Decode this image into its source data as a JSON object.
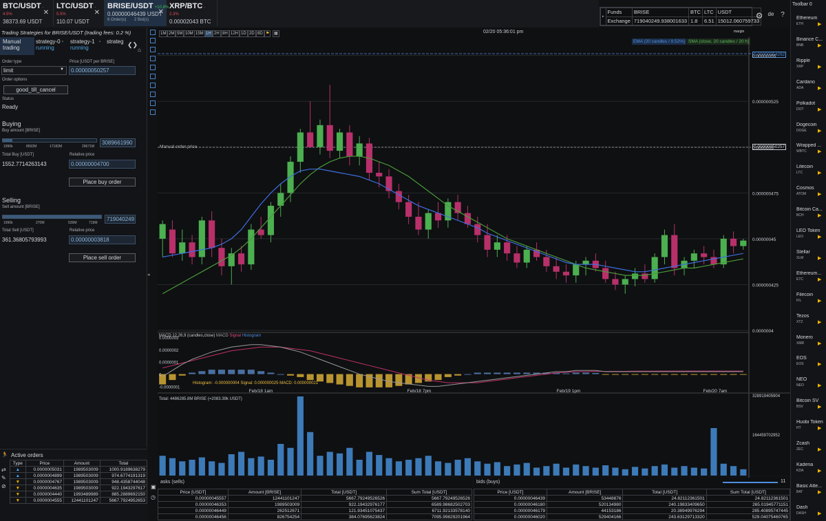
{
  "tabs": [
    {
      "symbol": "BTC/USDT",
      "change": "-4.5%",
      "price": "38373.69 USDT",
      "active": false
    },
    {
      "symbol": "LTC/USDT",
      "change": "-5.5%",
      "price": "110.07 USDT",
      "active": false
    },
    {
      "symbol": "BRISE/USDT",
      "change": "+10.8%",
      "price": "0.00000046439 USDT",
      "orders": "6 Order(s)",
      "bots": "2 Bot(s)",
      "active": true
    },
    {
      "symbol": "XRP/BTC",
      "change": "-2.3%",
      "price": "0.00002043 BTC",
      "active": false
    }
  ],
  "funds": {
    "h": [
      "Funds",
      "BRISE",
      "BTC",
      "LTC",
      "USDT"
    ],
    "row_label": "Exchange",
    "vals": [
      "719040249.938001633",
      "1.8",
      "6.51",
      "15012.060759733"
    ]
  },
  "right_toolbar": {
    "title": "Toolbar 0",
    "lang": "de"
  },
  "left": {
    "title": "Trading Strategies for BRISE/USDT (trading fees: 0.2 %)",
    "strategy_tabs": [
      {
        "name": "Manual trading",
        "status": ""
      },
      {
        "name": "strategy-0",
        "status": "running"
      },
      {
        "name": "strategy-1",
        "status": "running"
      },
      {
        "name": "strateg",
        "status": ""
      }
    ],
    "order_type_label": "Order type",
    "order_type": "limit",
    "price_label": "Price [USDT per BRISE]",
    "price": "0.00000050257",
    "order_options_label": "Order options",
    "order_option": "good_till_cancel",
    "status_label": "Status",
    "status": "Ready",
    "buying": "Buying",
    "buy_amount_label": "Buy amount [BRISE]",
    "buy_ticks": [
      "1990k",
      "8592M",
      "17182M",
      "29671M"
    ],
    "buy_amount": "3089661990",
    "buy_fill": 0.1,
    "total_buy_label": "Total Buy [USDT]",
    "total_buy": "1552.7714263143",
    "rel_price_label": "Relative price",
    "buy_rel_price": "0.00000004700",
    "place_buy": "Place buy order",
    "selling": "Selling",
    "sell_amount_label": "Sell amount [BRISE]",
    "sell_ticks": [
      "1990k",
      "270M",
      "539M",
      "719M"
    ],
    "sell_amount": "719040249",
    "sell_fill": 1.0,
    "total_sell_label": "Total Sell [USDT]",
    "total_sell": "361.36805793993",
    "sell_rel_price": "0.00000003818",
    "place_sell": "Place sell order"
  },
  "timeframes": [
    "1M",
    "2M",
    "5M",
    "10M",
    "15M",
    "1H",
    "2H",
    "8H",
    "12H",
    "1D",
    "2D",
    "8D"
  ],
  "selected_timeframe": "1H",
  "chart_header": {
    "datetime": "02/20 05:36:01 pm",
    "margin": "margin"
  },
  "legend": {
    "ema": "EMA (20 candles / 9.52%)",
    "sma": "SMA (close, 20 candles / 20 h)"
  },
  "manual_order_label": "Manual order price",
  "price_axis": [
    "0.00000055",
    "0.000000525",
    "0.0000005",
    "0.000000475",
    "0.00000045",
    "0.000000425",
    "0.0000004"
  ],
  "price_tags": {
    "top": "0.00000054292",
    "manual": "0.00000050257"
  },
  "x_axis": [
    "Feb/18 1am",
    "Feb/18 7pm",
    "Feb/19 1pm",
    "Feb/20 7am"
  ],
  "macd": {
    "title": "MACD 12,26,9 (candles,close)",
    "legend": [
      "MACD",
      "Signal",
      "Histogram"
    ],
    "axis": [
      "0.0000003",
      "0.0000002",
      "0.0000001",
      "0",
      "-0.0000001"
    ],
    "footer": "Histogram: -0.000000004  Signal: 0.000000025  MACD: 0.000000021"
  },
  "volume": {
    "title": "Total: 4486285.8M BRISE (=2083.39k USDT)",
    "axis_top": "328919405904",
    "axis_mid": "164459702952"
  },
  "chart_data": {
    "type": "bar",
    "candles": [
      {
        "o": 0.45,
        "h": 0.46,
        "l": 0.44,
        "c": 0.458
      },
      {
        "o": 0.455,
        "h": 0.46,
        "l": 0.44,
        "c": 0.442
      },
      {
        "o": 0.442,
        "h": 0.455,
        "l": 0.438,
        "c": 0.448
      },
      {
        "o": 0.448,
        "h": 0.452,
        "l": 0.436,
        "c": 0.44
      },
      {
        "o": 0.44,
        "h": 0.462,
        "l": 0.436,
        "c": 0.46
      },
      {
        "o": 0.46,
        "h": 0.465,
        "l": 0.44,
        "c": 0.445
      },
      {
        "o": 0.445,
        "h": 0.45,
        "l": 0.43,
        "c": 0.435
      },
      {
        "o": 0.435,
        "h": 0.445,
        "l": 0.425,
        "c": 0.442
      },
      {
        "o": 0.442,
        "h": 0.446,
        "l": 0.432,
        "c": 0.436
      },
      {
        "o": 0.436,
        "h": 0.458,
        "l": 0.433,
        "c": 0.455
      },
      {
        "o": 0.455,
        "h": 0.462,
        "l": 0.45,
        "c": 0.452
      },
      {
        "o": 0.452,
        "h": 0.47,
        "l": 0.448,
        "c": 0.468
      },
      {
        "o": 0.468,
        "h": 0.48,
        "l": 0.462,
        "c": 0.475
      },
      {
        "o": 0.475,
        "h": 0.495,
        "l": 0.47,
        "c": 0.492
      },
      {
        "o": 0.492,
        "h": 0.51,
        "l": 0.486,
        "c": 0.508
      },
      {
        "o": 0.508,
        "h": 0.525,
        "l": 0.5,
        "c": 0.5
      },
      {
        "o": 0.5,
        "h": 0.515,
        "l": 0.496,
        "c": 0.512
      },
      {
        "o": 0.512,
        "h": 0.534,
        "l": 0.494,
        "c": 0.498
      },
      {
        "o": 0.498,
        "h": 0.51,
        "l": 0.494,
        "c": 0.508
      },
      {
        "o": 0.508,
        "h": 0.512,
        "l": 0.49,
        "c": 0.495
      },
      {
        "o": 0.495,
        "h": 0.506,
        "l": 0.49,
        "c": 0.502
      },
      {
        "o": 0.502,
        "h": 0.505,
        "l": 0.482,
        "c": 0.486
      },
      {
        "o": 0.486,
        "h": 0.492,
        "l": 0.478,
        "c": 0.484
      },
      {
        "o": 0.484,
        "h": 0.488,
        "l": 0.472,
        "c": 0.476
      },
      {
        "o": 0.476,
        "h": 0.48,
        "l": 0.466,
        "c": 0.47
      },
      {
        "o": 0.47,
        "h": 0.474,
        "l": 0.458,
        "c": 0.462
      },
      {
        "o": 0.462,
        "h": 0.47,
        "l": 0.452,
        "c": 0.455
      },
      {
        "o": 0.455,
        "h": 0.466,
        "l": 0.45,
        "c": 0.464
      },
      {
        "o": 0.464,
        "h": 0.47,
        "l": 0.456,
        "c": 0.46
      },
      {
        "o": 0.46,
        "h": 0.472,
        "l": 0.456,
        "c": 0.47
      },
      {
        "o": 0.47,
        "h": 0.474,
        "l": 0.46,
        "c": 0.464
      },
      {
        "o": 0.464,
        "h": 0.468,
        "l": 0.456,
        "c": 0.458
      },
      {
        "o": 0.458,
        "h": 0.462,
        "l": 0.448,
        "c": 0.452
      },
      {
        "o": 0.452,
        "h": 0.458,
        "l": 0.44,
        "c": 0.444
      },
      {
        "o": 0.444,
        "h": 0.452,
        "l": 0.44,
        "c": 0.448
      },
      {
        "o": 0.448,
        "h": 0.452,
        "l": 0.438,
        "c": 0.442
      },
      {
        "o": 0.442,
        "h": 0.446,
        "l": 0.434,
        "c": 0.437
      },
      {
        "o": 0.437,
        "h": 0.446,
        "l": 0.434,
        "c": 0.444
      },
      {
        "o": 0.444,
        "h": 0.448,
        "l": 0.438,
        "c": 0.44
      },
      {
        "o": 0.44,
        "h": 0.444,
        "l": 0.432,
        "c": 0.435
      },
      {
        "o": 0.435,
        "h": 0.44,
        "l": 0.428,
        "c": 0.432
      },
      {
        "o": 0.432,
        "h": 0.436,
        "l": 0.426,
        "c": 0.43
      },
      {
        "o": 0.43,
        "h": 0.438,
        "l": 0.426,
        "c": 0.436
      },
      {
        "o": 0.436,
        "h": 0.44,
        "l": 0.43,
        "c": 0.438
      },
      {
        "o": 0.438,
        "h": 0.442,
        "l": 0.432,
        "c": 0.434
      },
      {
        "o": 0.434,
        "h": 0.438,
        "l": 0.426,
        "c": 0.428
      },
      {
        "o": 0.428,
        "h": 0.432,
        "l": 0.422,
        "c": 0.425
      },
      {
        "o": 0.425,
        "h": 0.43,
        "l": 0.42,
        "c": 0.428
      },
      {
        "o": 0.428,
        "h": 0.434,
        "l": 0.424,
        "c": 0.431
      },
      {
        "o": 0.431,
        "h": 0.436,
        "l": 0.426,
        "c": 0.428
      },
      {
        "o": 0.428,
        "h": 0.442,
        "l": 0.426,
        "c": 0.44
      },
      {
        "o": 0.44,
        "h": 0.455,
        "l": 0.436,
        "c": 0.452
      },
      {
        "o": 0.452,
        "h": 0.458,
        "l": 0.43,
        "c": 0.434
      },
      {
        "o": 0.434,
        "h": 0.44,
        "l": 0.43,
        "c": 0.438
      },
      {
        "o": 0.438,
        "h": 0.444,
        "l": 0.434,
        "c": 0.442
      },
      {
        "o": 0.442,
        "h": 0.446,
        "l": 0.436,
        "c": 0.44
      },
      {
        "o": 0.44,
        "h": 0.444,
        "l": 0.434,
        "c": 0.436
      },
      {
        "o": 0.436,
        "h": 0.452,
        "l": 0.434,
        "c": 0.45
      },
      {
        "o": 0.45,
        "h": 0.454,
        "l": 0.442,
        "c": 0.446
      },
      {
        "o": 0.446,
        "h": 0.45,
        "l": 0.444,
        "c": 0.449
      }
    ],
    "ema": [
      0.44,
      0.441,
      0.442,
      0.443,
      0.444,
      0.445,
      0.447,
      0.45,
      0.455,
      0.462,
      0.469,
      0.475,
      0.48,
      0.484,
      0.487,
      0.488,
      0.488,
      0.487,
      0.486,
      0.485,
      0.484,
      0.482,
      0.48,
      0.477,
      0.474,
      0.471,
      0.468,
      0.466,
      0.464,
      0.462,
      0.46,
      0.458,
      0.456,
      0.453,
      0.451,
      0.449,
      0.447,
      0.445,
      0.443,
      0.441,
      0.439,
      0.437,
      0.436,
      0.436,
      0.436,
      0.435,
      0.434,
      0.433,
      0.432,
      0.432,
      0.433,
      0.434,
      0.435,
      0.436,
      0.437,
      0.438,
      0.439,
      0.44,
      0.441,
      0.442
    ],
    "sma": [
      0.42,
      0.423,
      0.426,
      0.429,
      0.432,
      0.435,
      0.438,
      0.441,
      0.445,
      0.45,
      0.456,
      0.462,
      0.468,
      0.474,
      0.48,
      0.485,
      0.489,
      0.492,
      0.494,
      0.495,
      0.495,
      0.494,
      0.492,
      0.49,
      0.487,
      0.484,
      0.48,
      0.476,
      0.472,
      0.468,
      0.465,
      0.462,
      0.459,
      0.456,
      0.453,
      0.45,
      0.448,
      0.446,
      0.444,
      0.442,
      0.44,
      0.438,
      0.436,
      0.434,
      0.433,
      0.432,
      0.431,
      0.43,
      0.43,
      0.43,
      0.431,
      0.432,
      0.433,
      0.434,
      0.434,
      0.435,
      0.436,
      0.437,
      0.438,
      0.439
    ],
    "volume": [
      0.25,
      0.22,
      0.18,
      0.2,
      0.23,
      0.18,
      0.16,
      0.27,
      0.3,
      0.22,
      0.24,
      0.2,
      0.4,
      0.35,
      1.0,
      0.55,
      0.25,
      0.3,
      0.28,
      0.35,
      0.2,
      0.3,
      0.26,
      0.22,
      0.18,
      0.2,
      0.22,
      0.25,
      0.18,
      0.16,
      0.2,
      0.22,
      0.18,
      0.15,
      0.17,
      0.12,
      0.14,
      0.16,
      0.1,
      0.12,
      0.15,
      0.1,
      0.14,
      0.12,
      0.1,
      0.13,
      0.1,
      0.08,
      0.11,
      0.09,
      0.12,
      0.14,
      0.1,
      0.12,
      0.1,
      0.09,
      0.6,
      0.15,
      0.12,
      0.08
    ],
    "macd": [
      -0.02,
      0.03,
      0.08,
      0.12,
      0.15,
      0.18,
      0.2,
      0.22,
      0.23,
      0.24,
      0.24,
      0.23,
      0.22,
      0.2,
      0.18,
      0.15,
      0.12,
      0.09,
      0.06,
      0.03,
      0.0,
      -0.02,
      -0.04,
      -0.06,
      -0.07,
      -0.08,
      -0.09,
      -0.1,
      -0.1,
      -0.09,
      -0.08,
      -0.07,
      -0.06,
      -0.05,
      -0.04,
      -0.03,
      -0.02,
      -0.01,
      0.0,
      0.01,
      0.02,
      0.02,
      0.03,
      0.03,
      0.03,
      0.02,
      0.02,
      0.02,
      0.02,
      0.02,
      0.02,
      0.02,
      0.02,
      0.02,
      0.02,
      0.02,
      0.02,
      0.02,
      0.02,
      0.021
    ],
    "signal": [
      0.05,
      0.07,
      0.09,
      0.11,
      0.13,
      0.15,
      0.17,
      0.19,
      0.2,
      0.21,
      0.22,
      0.22,
      0.22,
      0.21,
      0.2,
      0.19,
      0.17,
      0.15,
      0.13,
      0.11,
      0.09,
      0.07,
      0.05,
      0.03,
      0.01,
      -0.01,
      -0.03,
      -0.05,
      -0.06,
      -0.07,
      -0.07,
      -0.07,
      -0.07,
      -0.06,
      -0.05,
      -0.04,
      -0.03,
      -0.02,
      -0.01,
      0.0,
      0.01,
      0.015,
      0.02,
      0.02,
      0.022,
      0.022,
      0.023,
      0.023,
      0.024,
      0.024,
      0.024,
      0.025,
      0.025,
      0.025,
      0.025,
      0.025,
      0.025,
      0.025,
      0.025,
      0.025
    ]
  },
  "right_coins": [
    {
      "name": "Ethereum",
      "ticker": "ETH"
    },
    {
      "name": "Binance C...",
      "ticker": "BNB"
    },
    {
      "name": "Ripple",
      "ticker": "XRP"
    },
    {
      "name": "Cardano",
      "ticker": "ADA"
    },
    {
      "name": "Polkadot",
      "ticker": "DOT"
    },
    {
      "name": "Dogecoin",
      "ticker": "DOGE"
    },
    {
      "name": "Wrapped ...",
      "ticker": "WBTC"
    },
    {
      "name": "Litecoin",
      "ticker": "LTC"
    },
    {
      "name": "Cosmos",
      "ticker": "ATOM"
    },
    {
      "name": "Bitcoin Ca...",
      "ticker": "BCH"
    },
    {
      "name": "LEO Token",
      "ticker": "LEO"
    },
    {
      "name": "Stellar",
      "ticker": "XLM"
    },
    {
      "name": "Ethereum...",
      "ticker": "ETC"
    },
    {
      "name": "Filecoin",
      "ticker": "FIL"
    },
    {
      "name": "Tezos",
      "ticker": "XTZ"
    },
    {
      "name": "Monero",
      "ticker": "XMR"
    },
    {
      "name": "EOS",
      "ticker": "EOS"
    },
    {
      "name": "NEO",
      "ticker": "NEO"
    },
    {
      "name": "Bitcoin SV",
      "ticker": "BSV"
    },
    {
      "name": "Huobi Token",
      "ticker": "HT"
    },
    {
      "name": "Zcash",
      "ticker": "ZEC"
    },
    {
      "name": "Kadena",
      "ticker": "KDA"
    },
    {
      "name": "Basic Atte...",
      "ticker": "BAT"
    },
    {
      "name": "Dash",
      "ticker": "DASH"
    }
  ],
  "active_orders": {
    "title": "Active orders",
    "headers": [
      "Type",
      "Price",
      "Amount",
      "Total"
    ],
    "rows": [
      [
        "▲",
        "0.0000005031",
        "1989503009",
        "1000.9189638279"
      ],
      [
        "▲",
        "0.0000004899",
        "1989503009",
        "974.6774191319"
      ],
      [
        "▼",
        "0.0000004767",
        "1989503009",
        "948.4358744048"
      ],
      [
        "▼",
        "0.0000004635",
        "1989503009",
        "922.1943297617"
      ],
      [
        "▼",
        "0.0000004440",
        "1993489989",
        "885.2889692150"
      ],
      [
        "▼",
        "0.0000004555",
        "12441101247",
        "5667.7924952653"
      ]
    ]
  },
  "asks": {
    "title": "asks (sells)",
    "headers": [
      "Price [USDT]",
      "Amount [BRISE]",
      "Total [USDT]",
      "Sum Total [USDT]"
    ],
    "rows": [
      [
        "0.00000045557",
        "12441101247",
        "5667.79249526526",
        "5667.79249526526"
      ],
      [
        "0.00000046353",
        "1989503009",
        "922.19432976177",
        "6589.98682502703"
      ],
      [
        "0.00000046449",
        "262512671",
        "121.93451075437",
        "6711.92133578140"
      ],
      [
        "0.00000046456",
        "826754254",
        "384.07695623824",
        "7095.99829201964"
      ]
    ]
  },
  "bids": {
    "title": "bids (buys)",
    "count": "11",
    "headers": [
      "Price [USDT]",
      "Amount [BRISE]",
      "Total [USDT]",
      "Sum Total [USDT]"
    ],
    "rows": [
      [
        "0.00000046439",
        "53448876",
        "24.82112361501",
        "24.82112361501"
      ],
      [
        "0.00000046180",
        "520134980",
        "240.19833409650",
        "265.01945771151"
      ],
      [
        "0.00000046179",
        "44153186",
        "20.38949976294",
        "285.40895747445"
      ],
      [
        "0.00000046020",
        "529404166",
        "243.63129713320",
        "529.04075460765"
      ]
    ]
  }
}
